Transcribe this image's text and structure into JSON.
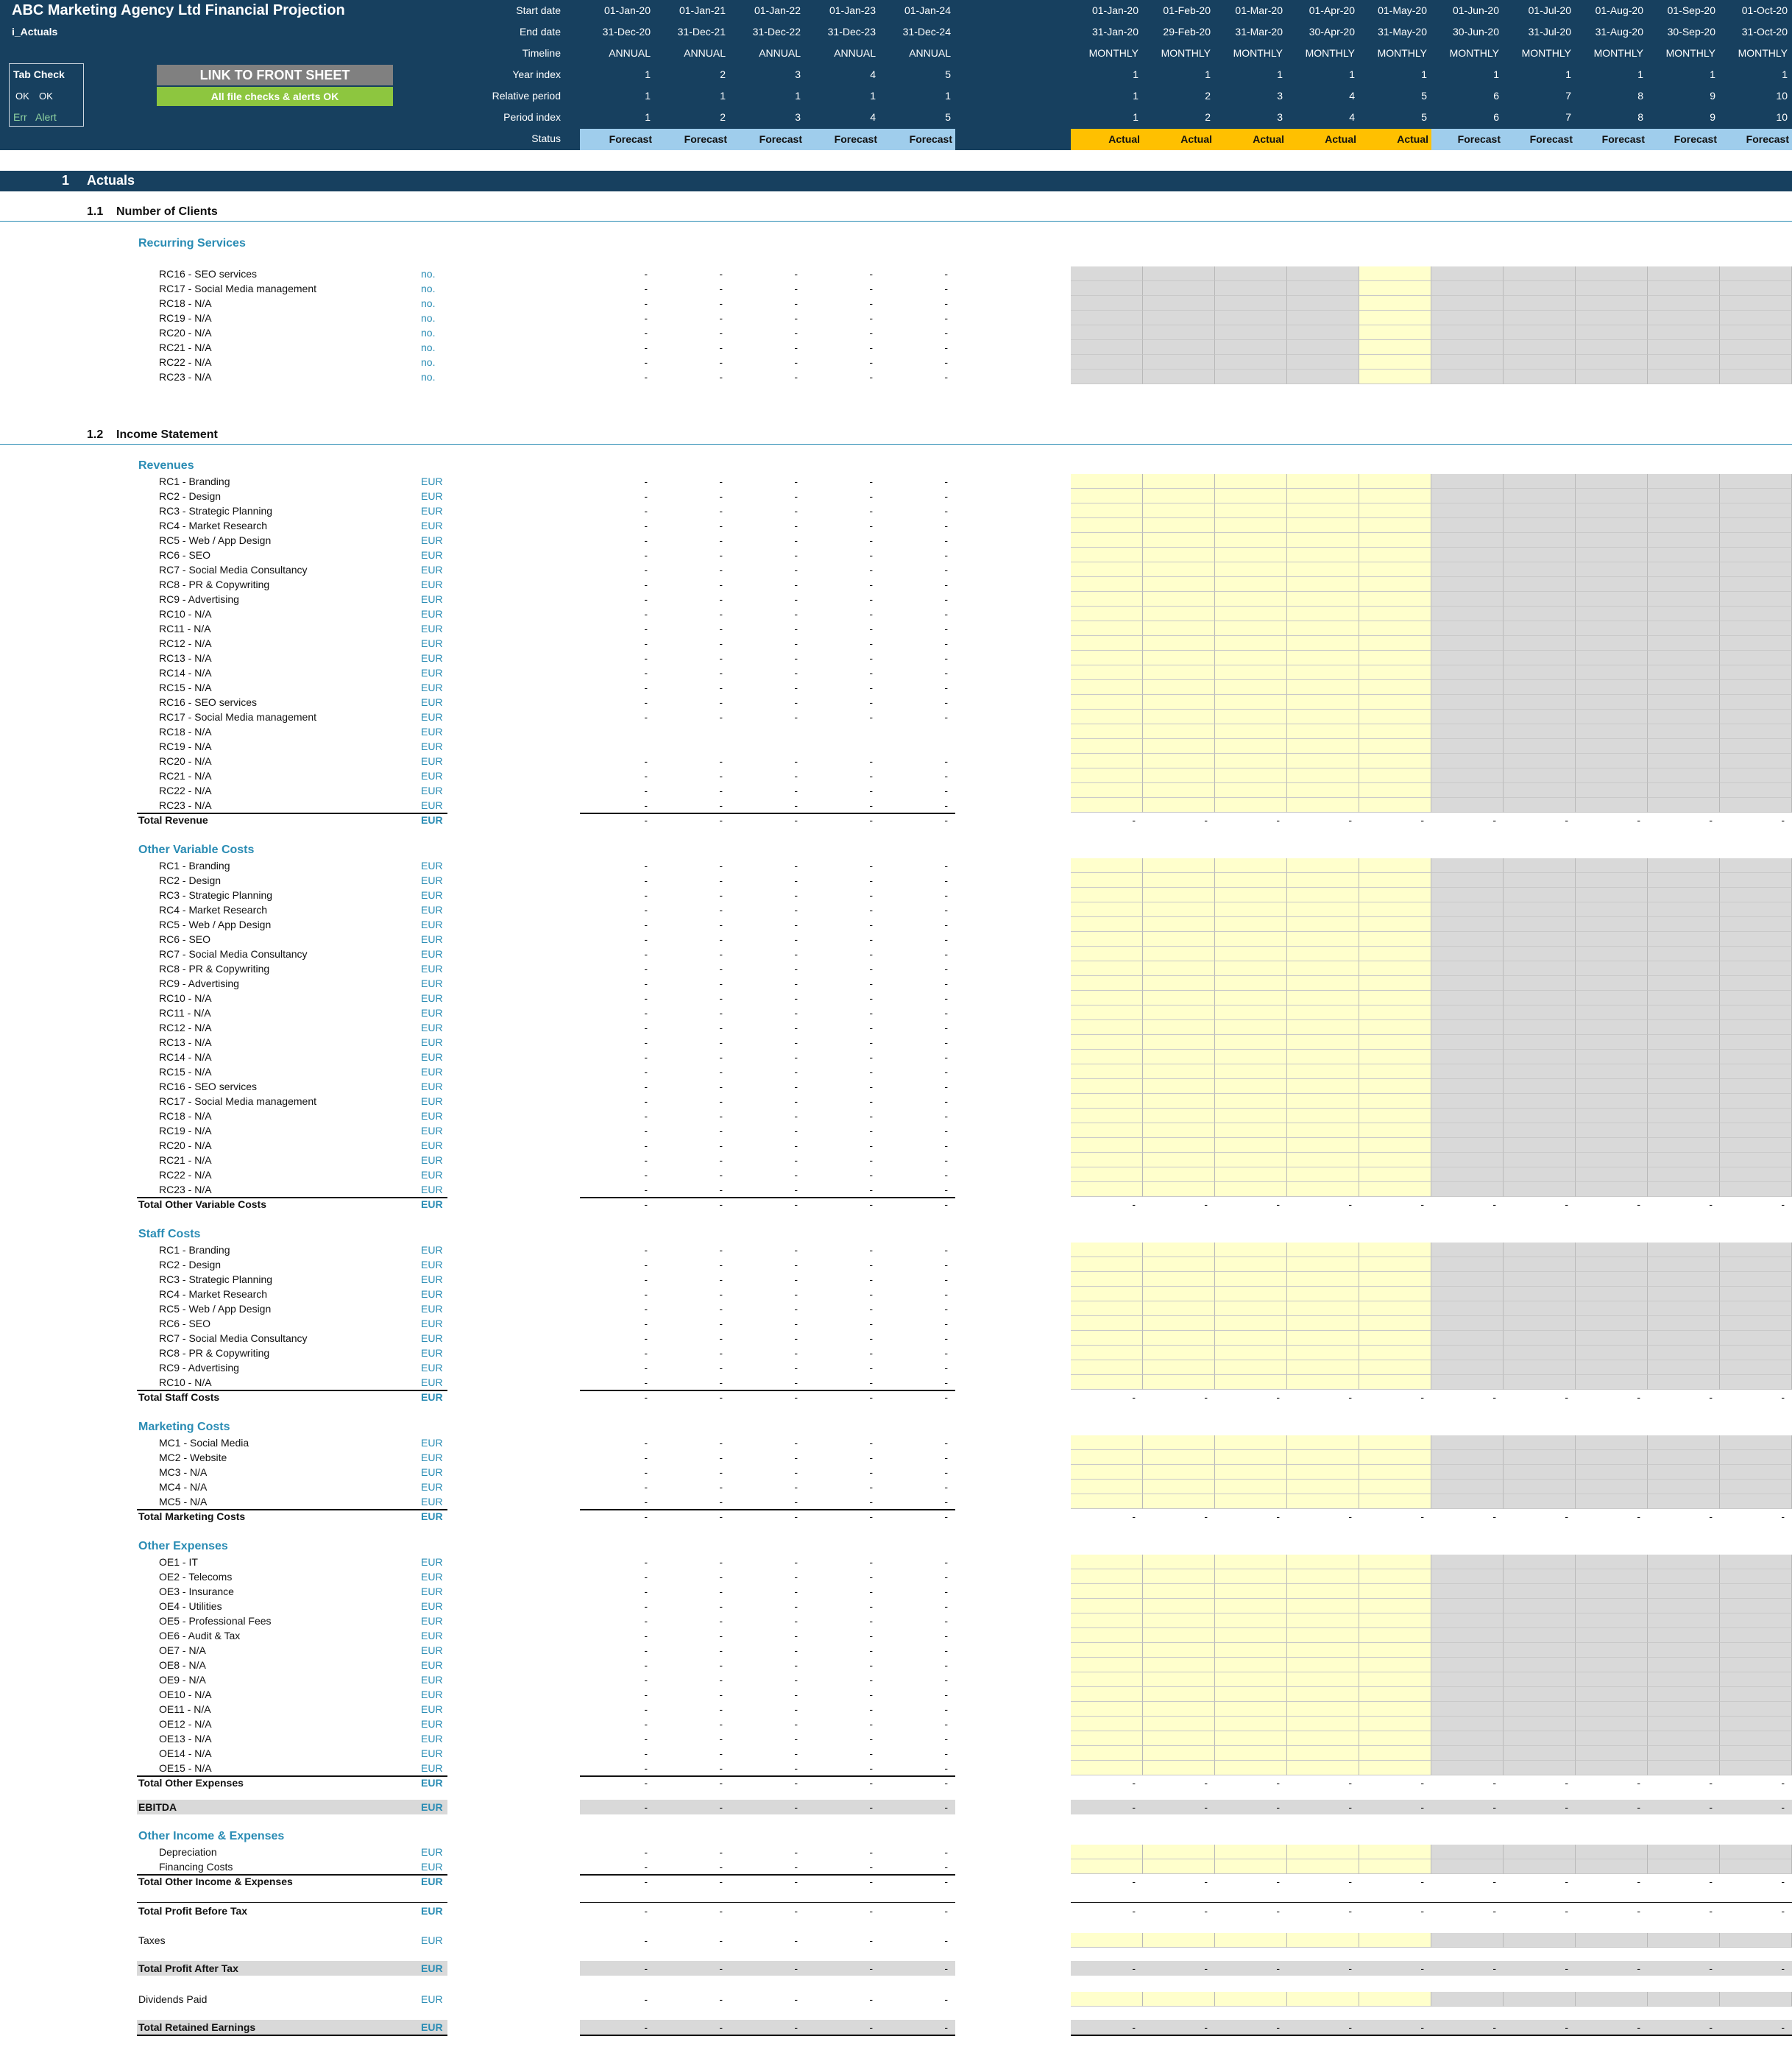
{
  "title": "ABC Marketing Agency Ltd Financial Projection",
  "sheet_name": "i_Actuals",
  "tab_check": {
    "title": "Tab Check",
    "ok1": "OK",
    "ok2": "OK",
    "err": "Err",
    "alert": "Alert"
  },
  "link_button": "LINK TO FRONT SHEET",
  "checks_status": "All file checks & alerts OK",
  "header_labels": [
    "Start date",
    "End date",
    "Timeline",
    "Year index",
    "Relative period",
    "Period index",
    "Status"
  ],
  "annual_cols": [
    {
      "start": "01-Jan-20",
      "end": "31-Dec-20",
      "timeline": "ANNUAL",
      "year": "1",
      "rel": "1",
      "period": "1",
      "status": "Forecast"
    },
    {
      "start": "01-Jan-21",
      "end": "31-Dec-21",
      "timeline": "ANNUAL",
      "year": "2",
      "rel": "1",
      "period": "2",
      "status": "Forecast"
    },
    {
      "start": "01-Jan-22",
      "end": "31-Dec-22",
      "timeline": "ANNUAL",
      "year": "3",
      "rel": "1",
      "period": "3",
      "status": "Forecast"
    },
    {
      "start": "01-Jan-23",
      "end": "31-Dec-23",
      "timeline": "ANNUAL",
      "year": "4",
      "rel": "1",
      "period": "4",
      "status": "Forecast"
    },
    {
      "start": "01-Jan-24",
      "end": "31-Dec-24",
      "timeline": "ANNUAL",
      "year": "5",
      "rel": "1",
      "period": "5",
      "status": "Forecast"
    }
  ],
  "monthly_cols": [
    {
      "start": "01-Jan-20",
      "end": "31-Jan-20",
      "timeline": "MONTHLY",
      "year": "1",
      "rel": "1",
      "period": "1",
      "status": "Actual"
    },
    {
      "start": "01-Feb-20",
      "end": "29-Feb-20",
      "timeline": "MONTHLY",
      "year": "1",
      "rel": "2",
      "period": "2",
      "status": "Actual"
    },
    {
      "start": "01-Mar-20",
      "end": "31-Mar-20",
      "timeline": "MONTHLY",
      "year": "1",
      "rel": "3",
      "period": "3",
      "status": "Actual"
    },
    {
      "start": "01-Apr-20",
      "end": "30-Apr-20",
      "timeline": "MONTHLY",
      "year": "1",
      "rel": "4",
      "period": "4",
      "status": "Actual"
    },
    {
      "start": "01-May-20",
      "end": "31-May-20",
      "timeline": "MONTHLY",
      "year": "1",
      "rel": "5",
      "period": "5",
      "status": "Actual"
    },
    {
      "start": "01-Jun-20",
      "end": "30-Jun-20",
      "timeline": "MONTHLY",
      "year": "1",
      "rel": "6",
      "period": "6",
      "status": "Forecast"
    },
    {
      "start": "01-Jul-20",
      "end": "31-Jul-20",
      "timeline": "MONTHLY",
      "year": "1",
      "rel": "7",
      "period": "7",
      "status": "Forecast"
    },
    {
      "start": "01-Aug-20",
      "end": "31-Aug-20",
      "timeline": "MONTHLY",
      "year": "1",
      "rel": "8",
      "period": "8",
      "status": "Forecast"
    },
    {
      "start": "01-Sep-20",
      "end": "30-Sep-20",
      "timeline": "MONTHLY",
      "year": "1",
      "rel": "9",
      "period": "9",
      "status": "Forecast"
    },
    {
      "start": "01-Oct-20",
      "end": "31-Oct-20",
      "timeline": "MONTHLY",
      "year": "1",
      "rel": "10",
      "period": "10",
      "status": "Forecast"
    }
  ],
  "colors": {
    "header_bg": "#17405f",
    "forecast": "#9fcdec",
    "actual": "#ffc000",
    "input_yellow": "#ffffcc",
    "input_gray": "#d9d9d9",
    "units": "#2a8cb4",
    "link_button": "#808080",
    "checks_ok": "#8dc63f"
  },
  "dash": "-",
  "section": {
    "number": "1",
    "title": "Actuals"
  },
  "subsections": [
    {
      "number": "1.1",
      "title": "Number of Clients"
    },
    {
      "number": "1.2",
      "title": "Income Statement"
    }
  ],
  "recurring": {
    "title": "Recurring Services",
    "unit": "no.",
    "items": [
      "RC16 - SEO services",
      "RC17 - Social Media management",
      "RC18 - N/A",
      "RC19 - N/A",
      "RC20 - N/A",
      "RC21 - N/A",
      "RC22 - N/A",
      "RC23 - N/A"
    ]
  },
  "blocks": [
    {
      "title": "Revenues",
      "unit": "EUR",
      "total": "Total Revenue",
      "items": [
        "RC1 - Branding",
        "RC2 - Design",
        "RC3 - Strategic Planning",
        "RC4 - Market Research",
        "RC5 - Web / App Design",
        "RC6 - SEO",
        "RC7 - Social Media Consultancy",
        "RC8 - PR & Copywriting",
        "RC9 - Advertising",
        "RC10 - N/A",
        "RC11 - N/A",
        "RC12 - N/A",
        "RC13 - N/A",
        "RC14 - N/A",
        "RC15 - N/A",
        "RC16 - SEO services",
        "RC17 - Social Media management",
        "RC18 - N/A",
        "RC19 - N/A",
        "RC20 - N/A",
        "RC21 - N/A",
        "RC22 - N/A",
        "RC23 - N/A"
      ],
      "no_dash_rows": [
        17,
        18
      ]
    },
    {
      "title": "Other Variable Costs",
      "unit": "EUR",
      "total": "Total Other Variable Costs",
      "items": [
        "RC1 - Branding",
        "RC2 - Design",
        "RC3 - Strategic Planning",
        "RC4 - Market Research",
        "RC5 - Web / App Design",
        "RC6 - SEO",
        "RC7 - Social Media Consultancy",
        "RC8 - PR & Copywriting",
        "RC9 - Advertising",
        "RC10 - N/A",
        "RC11 - N/A",
        "RC12 - N/A",
        "RC13 - N/A",
        "RC14 - N/A",
        "RC15 - N/A",
        "RC16 - SEO services",
        "RC17 - Social Media management",
        "RC18 - N/A",
        "RC19 - N/A",
        "RC20 - N/A",
        "RC21 - N/A",
        "RC22 - N/A",
        "RC23 - N/A"
      ],
      "no_dash_rows": []
    },
    {
      "title": "Staff Costs",
      "unit": "EUR",
      "total": "Total Staff Costs",
      "items": [
        "RC1 - Branding",
        "RC2 - Design",
        "RC3 - Strategic Planning",
        "RC4 - Market Research",
        "RC5 - Web / App Design",
        "RC6 - SEO",
        "RC7 - Social Media Consultancy",
        "RC8 - PR & Copywriting",
        "RC9 - Advertising",
        "RC10 - N/A"
      ],
      "no_dash_rows": []
    },
    {
      "title": "Marketing Costs",
      "unit": "EUR",
      "total": "Total Marketing Costs",
      "items": [
        "MC1 - Social Media",
        "MC2 - Website",
        "MC3 - N/A",
        "MC4 - N/A",
        "MC5 - N/A"
      ],
      "no_dash_rows": []
    },
    {
      "title": "Other Expenses",
      "unit": "EUR",
      "total": "Total Other Expenses",
      "items": [
        "OE1 - IT",
        "OE2 - Telecoms",
        "OE3 - Insurance",
        "OE4 - Utilities",
        "OE5 - Professional Fees",
        "OE6 - Audit & Tax",
        "OE7 - N/A",
        "OE8 - N/A",
        "OE9 - N/A",
        "OE10 - N/A",
        "OE11 - N/A",
        "OE12 - N/A",
        "OE13 - N/A",
        "OE14 - N/A",
        "OE15 - N/A"
      ],
      "no_dash_rows": []
    }
  ],
  "ebitda": {
    "label": "EBITDA",
    "unit": "EUR"
  },
  "other_ie": {
    "title": "Other Income & Expenses",
    "unit": "EUR",
    "items": [
      "Depreciation",
      "Financing Costs"
    ],
    "total": "Total Other Income & Expenses"
  },
  "profit_before_tax": {
    "label": "Total Profit Before Tax",
    "unit": "EUR"
  },
  "taxes": {
    "label": "Taxes",
    "unit": "EUR"
  },
  "profit_after_tax": {
    "label": "Total Profit After Tax",
    "unit": "EUR"
  },
  "dividends": {
    "label": "Dividends Paid",
    "unit": "EUR"
  },
  "retained": {
    "label": "Total Retained Earnings",
    "unit": "EUR"
  }
}
